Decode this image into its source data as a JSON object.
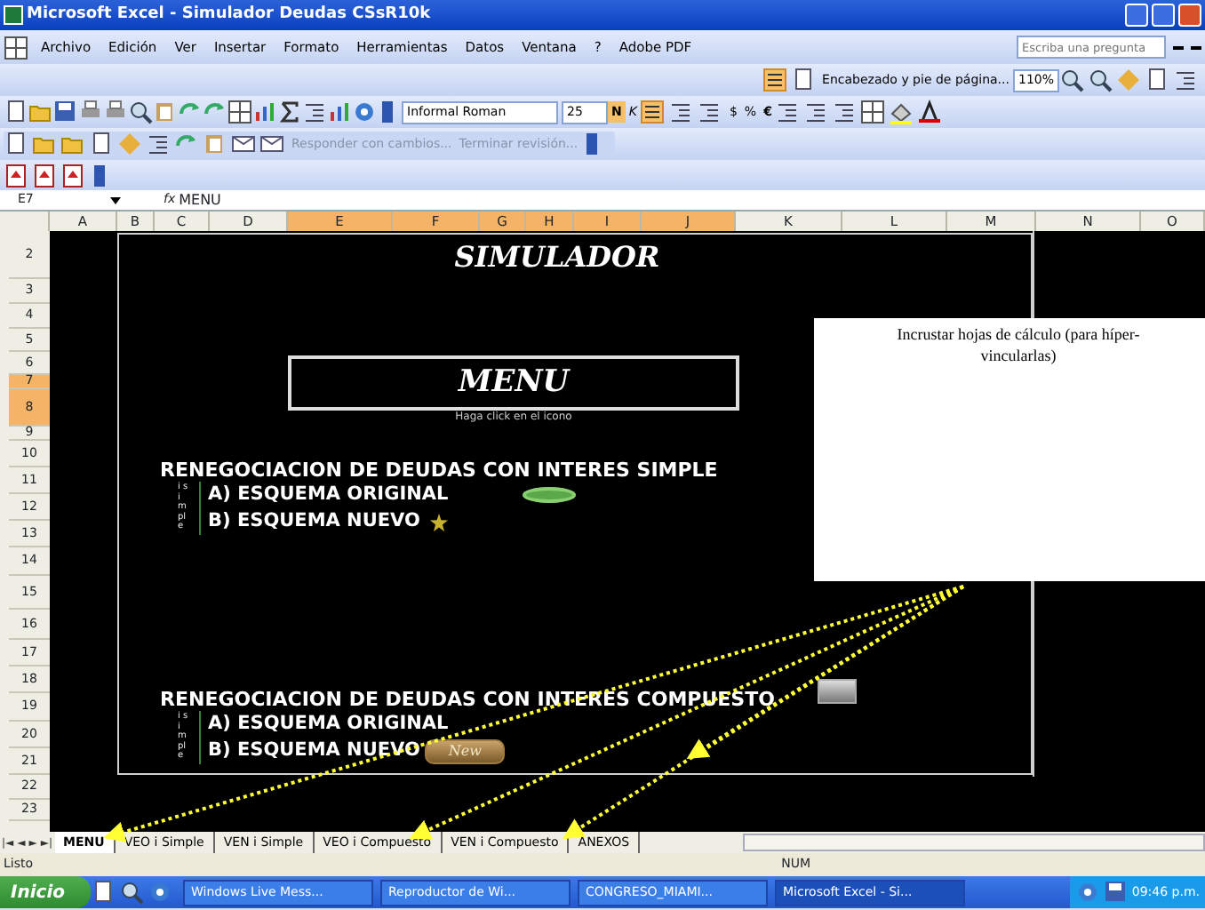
{
  "window": {
    "title": "Microsoft Excel - Simulador Deudas CSsR10k"
  },
  "menu": [
    "Archivo",
    "Edición",
    "Ver",
    "Insertar",
    "Formato",
    "Herramientas",
    "Datos",
    "Ventana",
    "?",
    "Adobe PDF"
  ],
  "help_field": {
    "placeholder": "Escriba una pregunta"
  },
  "header_toolbar": {
    "label": "Encabezado y pie de página...",
    "zoom": "110%"
  },
  "format_toolbar": {
    "font": "Informal Roman",
    "size": "25",
    "bold": "N",
    "italic": "K",
    "currency": "$",
    "percent": "%",
    "euro": "€"
  },
  "review_toolbar": [
    "Responder con cambios...",
    "Terminar revisión..."
  ],
  "formula_bar": {
    "cell": "E7",
    "fx": "fx",
    "formula": "MENU"
  },
  "columns": [
    {
      "label": "A",
      "selected": false
    },
    {
      "label": "B",
      "selected": false
    },
    {
      "label": "C",
      "selected": false
    },
    {
      "label": "D",
      "selected": false
    },
    {
      "label": "E",
      "selected": true
    },
    {
      "label": "F",
      "selected": true
    },
    {
      "label": "G",
      "selected": true
    },
    {
      "label": "H",
      "selected": true
    },
    {
      "label": "I",
      "selected": true
    },
    {
      "label": "J",
      "selected": true
    },
    {
      "label": "K",
      "selected": false
    },
    {
      "label": "L",
      "selected": false
    },
    {
      "label": "M",
      "selected": false
    },
    {
      "label": "N",
      "selected": false
    },
    {
      "label": "O",
      "selected": false
    }
  ],
  "rows": [
    {
      "label": "2",
      "selected": false
    },
    {
      "label": "3",
      "selected": false
    },
    {
      "label": "4",
      "selected": false
    },
    {
      "label": "5",
      "selected": false
    },
    {
      "label": "6",
      "selected": false
    },
    {
      "label": "7",
      "selected": true
    },
    {
      "label": "8",
      "selected": true
    },
    {
      "label": "9",
      "selected": false
    },
    {
      "label": "10",
      "selected": false
    },
    {
      "label": "11",
      "selected": false
    },
    {
      "label": "12",
      "selected": false
    },
    {
      "label": "13",
      "selected": false
    },
    {
      "label": "14",
      "selected": false
    },
    {
      "label": "15",
      "selected": false
    },
    {
      "label": "16",
      "selected": false
    },
    {
      "label": "17",
      "selected": false
    },
    {
      "label": "18",
      "selected": false
    },
    {
      "label": "19",
      "selected": false
    },
    {
      "label": "20",
      "selected": false
    },
    {
      "label": "21",
      "selected": false
    },
    {
      "label": "22",
      "selected": false
    },
    {
      "label": "23",
      "selected": false
    }
  ],
  "sheet": {
    "title": "SIMULADOR",
    "menu_box": "MENU",
    "menu_hint": "Haga click en el icono",
    "sections": [
      {
        "heading": "RENEGOCIACION DE DEUDAS CON INTERES SIMPLE",
        "side_label": "i simple",
        "items": [
          {
            "label": "A) ESQUEMA ORIGINAL",
            "kind": "oval"
          },
          {
            "label": "B) ESQUEMA NUEVO",
            "kind": "star"
          }
        ]
      },
      {
        "heading": "RENEGOCIACION DE DEUDAS CON INTERES COMPUESTO",
        "side_label": "i simple",
        "items": [
          {
            "label": "A) ESQUEMA ORIGINAL",
            "kind": "none"
          },
          {
            "label": "B) ESQUEMA NUEVO",
            "kind": "gold",
            "button": "New"
          }
        ]
      }
    ],
    "note": "Incrustar hojas de cálculo (para híper-vincularlas)"
  },
  "tab_nav": [
    "|◄",
    "◄",
    "►",
    "►|"
  ],
  "tabs": [
    {
      "label": "MENU",
      "selected": true
    },
    {
      "label": "VEO i Simple",
      "selected": false
    },
    {
      "label": "VEN i Simple",
      "selected": false
    },
    {
      "label": "VEO i Compuesto",
      "selected": false
    },
    {
      "label": "VEN i Compuesto",
      "selected": false
    },
    {
      "label": "ANEXOS",
      "selected": false
    }
  ],
  "status_bar": {
    "text": "Listo",
    "num": "NUM"
  },
  "taskbar": {
    "start": "Inicio",
    "tasks": [
      {
        "label": "Windows Live Mess...",
        "selected": false
      },
      {
        "label": "Reproductor de Wi...",
        "selected": false
      },
      {
        "label": "CONGRESO_MIAMI...",
        "selected": false
      },
      {
        "label": "Microsoft Excel - Si...",
        "selected": true
      }
    ],
    "clock": "09:46 p.m."
  }
}
